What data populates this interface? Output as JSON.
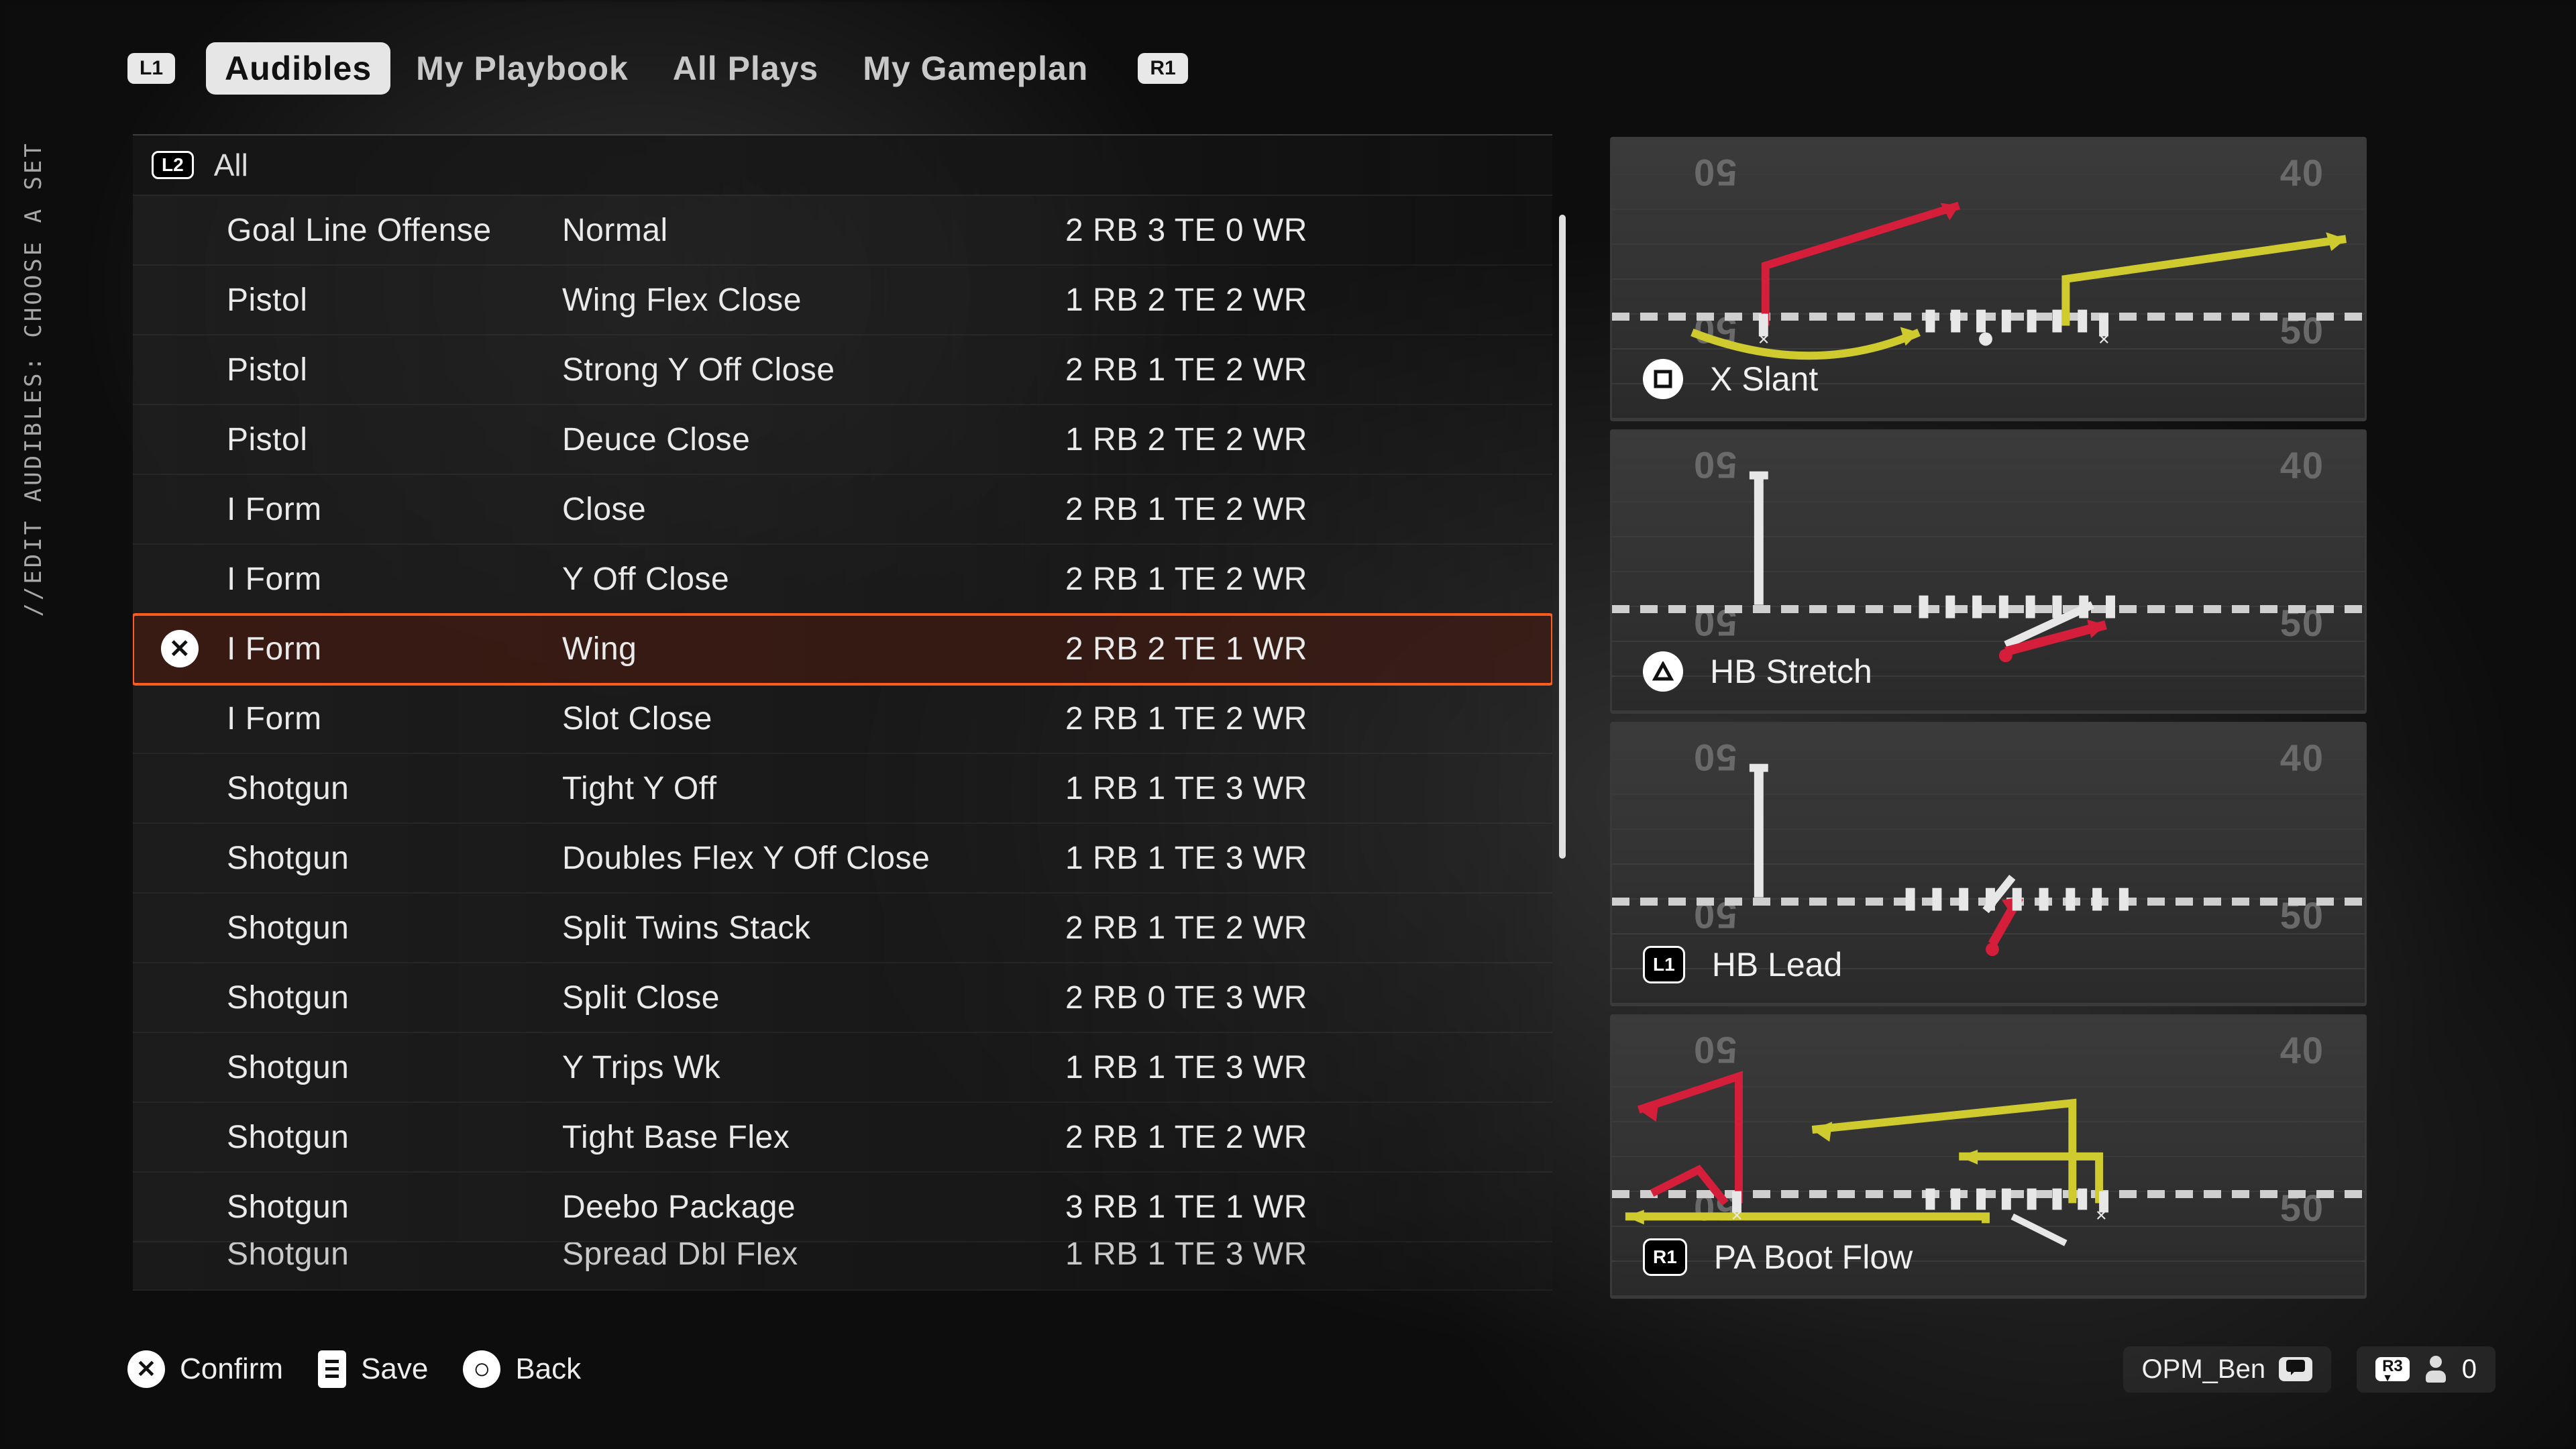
{
  "breadcrumb": "//EDIT AUDIBLES: CHOOSE A SET",
  "topbar": {
    "left_bumper": "L1",
    "right_bumper": "R1",
    "tabs": [
      {
        "label": "Audibles",
        "active": true
      },
      {
        "label": "My Playbook",
        "active": false
      },
      {
        "label": "All Plays",
        "active": false
      },
      {
        "label": "My Gameplan",
        "active": false
      }
    ]
  },
  "filter": {
    "button": "L2",
    "label": "All"
  },
  "rows": [
    {
      "formation": "Goal Line Offense",
      "set": "Normal",
      "personnel": "2 RB 3 TE 0 WR",
      "selected": false
    },
    {
      "formation": "Pistol",
      "set": "Wing Flex Close",
      "personnel": "1 RB 2 TE 2 WR",
      "selected": false
    },
    {
      "formation": "Pistol",
      "set": "Strong Y Off Close",
      "personnel": "2 RB 1 TE 2 WR",
      "selected": false
    },
    {
      "formation": "Pistol",
      "set": "Deuce Close",
      "personnel": "1 RB 2 TE 2 WR",
      "selected": false
    },
    {
      "formation": "I Form",
      "set": "Close",
      "personnel": "2 RB 1 TE 2 WR",
      "selected": false
    },
    {
      "formation": "I Form",
      "set": "Y Off Close",
      "personnel": "2 RB 1 TE 2 WR",
      "selected": false
    },
    {
      "formation": "I Form",
      "set": "Wing",
      "personnel": "2 RB 2 TE 1 WR",
      "selected": true,
      "btn": "✕"
    },
    {
      "formation": "I Form",
      "set": "Slot Close",
      "personnel": "2 RB 1 TE 2 WR",
      "selected": false
    },
    {
      "formation": "Shotgun",
      "set": "Tight Y Off",
      "personnel": "1 RB 1 TE 3 WR",
      "selected": false
    },
    {
      "formation": "Shotgun",
      "set": "Doubles Flex Y Off Close",
      "personnel": "1 RB 1 TE 3 WR",
      "selected": false
    },
    {
      "formation": "Shotgun",
      "set": "Split Twins Stack",
      "personnel": "2 RB 1 TE 2 WR",
      "selected": false
    },
    {
      "formation": "Shotgun",
      "set": "Split Close",
      "personnel": "2 RB 0 TE 3 WR",
      "selected": false
    },
    {
      "formation": "Shotgun",
      "set": "Y Trips Wk",
      "personnel": "1 RB 1 TE 3 WR",
      "selected": false
    },
    {
      "formation": "Shotgun",
      "set": "Tight Base Flex",
      "personnel": "2 RB 1 TE 2 WR",
      "selected": false
    },
    {
      "formation": "Shotgun",
      "set": "Deebo Package",
      "personnel": "3 RB 1 TE 1 WR",
      "selected": false
    },
    {
      "formation": "Shotgun",
      "set": "Spread Dbl Flex",
      "personnel": "1 RB 1 TE 3 WR",
      "selected": false,
      "partial": true
    }
  ],
  "plays": [
    {
      "name": "X Slant",
      "button_label": "",
      "button_shape": "square-glyph"
    },
    {
      "name": "HB Stretch",
      "button_label": "",
      "button_shape": "triangle-glyph"
    },
    {
      "name": "HB Lead",
      "button_label": "L1",
      "button_shape": "text-badge"
    },
    {
      "name": "PA Boot Flow",
      "button_label": "R1",
      "button_shape": "text-badge"
    }
  ],
  "bottom": {
    "confirm": {
      "icon": "✕",
      "label": "Confirm"
    },
    "save": {
      "label": "Save"
    },
    "back": {
      "icon": "○",
      "label": "Back"
    },
    "username": "OPM_Ben",
    "friends_button": "R3",
    "friends_count": "0"
  }
}
